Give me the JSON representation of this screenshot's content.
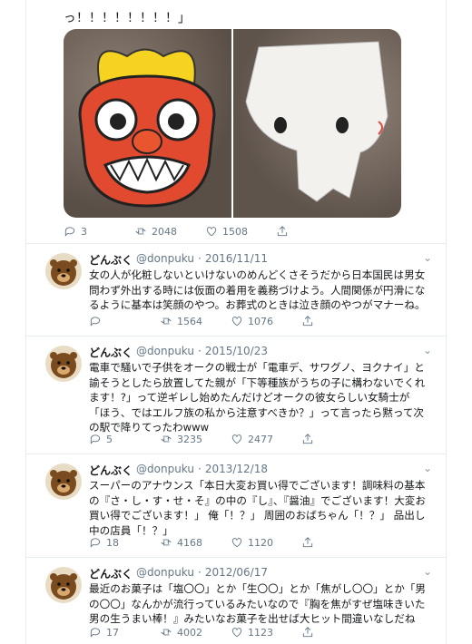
{
  "top_tweet": {
    "text_tail": "っ！！！！！！！！」",
    "actions": {
      "replies": "3",
      "retweets": "2048",
      "likes": "1508"
    }
  },
  "tweets": [
    {
      "name": "どんぶく",
      "handle": "@donpuku",
      "dot": "·",
      "date": "2016/11/11",
      "text": "女の人が化粧しないといけないのめんどくさそうだから日本国民は男女問わず外出する時には仮面の着用を義務づけよう。人間関係が円滑になるように基本は笑顔のやつ。お葬式のときは泣き顔のやつがマナーね。",
      "replies": "",
      "retweets": "1564",
      "likes": "1076"
    },
    {
      "name": "どんぶく",
      "handle": "@donpuku",
      "dot": "·",
      "date": "2015/10/23",
      "text": "電車で騒いで子供をオークの戦士が「電車デ、サワグノ、ヨクナイ」と諭そうとしたら放置してた親が「下等種族がうちの子に構わないでくれます！?」って逆ギレし始めたんだけどオークの彼女らしい女騎士が「ほう、ではエルフ族の私から注意すべきか？」って言ったら黙って次の駅で降りてったわwww",
      "replies": "5",
      "retweets": "3235",
      "likes": "2477"
    },
    {
      "name": "どんぶく",
      "handle": "@donpuku",
      "dot": "·",
      "date": "2013/12/18",
      "text": "スーパーのアナウンス「本日大変お買い得でございます！調味料の基本の『さ・し・す・せ・そ』の中の『し』、『醤油』でございます！大変お買い得でございます！」 俺「！？」 周囲のおばちゃん「！？」 品出し中の店員「！？」",
      "replies": "18",
      "retweets": "4168",
      "likes": "1120"
    },
    {
      "name": "どんぶく",
      "handle": "@donpuku",
      "dot": "·",
      "date": "2012/06/17",
      "text": "最近のお菓子は「塩〇〇」とか「生〇〇」とか「焦がし〇〇」とか「男の〇〇」なんかが流行っているみたいなので『胸を焦がすぜ塩味きいた男の生うまい棒！』みたいなお菓子を出せば大ヒット間違いなしだね",
      "replies": "17",
      "retweets": "4002",
      "likes": "1123"
    }
  ],
  "colors": {
    "accent": "#1da1f2",
    "muted": "#657786",
    "border": "#e6ecf0"
  }
}
